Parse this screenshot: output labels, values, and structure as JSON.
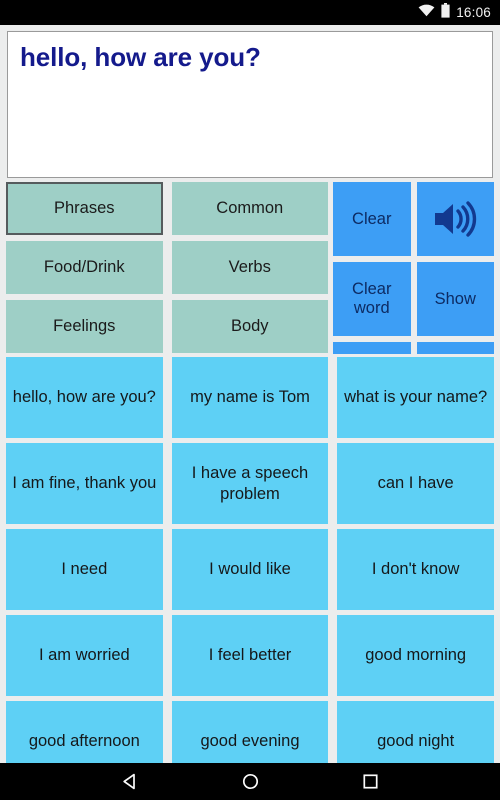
{
  "statusbar": {
    "time": "16:06",
    "wifi_icon": "wifi-icon",
    "battery_icon": "battery-full-icon"
  },
  "output": {
    "text": "hello, how are you?",
    "placeholder": "",
    "text_color": "#141a8c"
  },
  "categories": {
    "selected": "Phrases",
    "items": [
      {
        "label": "Phrases",
        "selected": true
      },
      {
        "label": "Common",
        "selected": false
      },
      {
        "label": "Food/Drink",
        "selected": false
      },
      {
        "label": "Verbs",
        "selected": false
      },
      {
        "label": "Feelings",
        "selected": false
      },
      {
        "label": "Body",
        "selected": false
      },
      {
        "label": "",
        "selected": false
      },
      {
        "label": "",
        "selected": false
      }
    ],
    "color": "#9ecfc6"
  },
  "controls": {
    "color": "#3d9ef5",
    "items": [
      {
        "label": "Clear",
        "icon": ""
      },
      {
        "label": "",
        "icon": "speaker-icon"
      },
      {
        "label": "Clear word",
        "icon": ""
      },
      {
        "label": "Show",
        "icon": ""
      },
      {
        "label": "",
        "icon": ""
      },
      {
        "label": "",
        "icon": ""
      }
    ]
  },
  "phrases": {
    "color": "#5ed0f5",
    "items": [
      "hello, how are you?",
      "my name is Tom",
      "what is your name?",
      "I am fine, thank you",
      "I have a speech problem",
      "can I have",
      "I need",
      "I would like",
      "I don't know",
      "I am worried",
      "I feel better",
      "good morning",
      "good afternoon",
      "good evening",
      "good night"
    ]
  },
  "navbar": {
    "back_icon": "back-triangle-icon",
    "home_icon": "home-circle-icon",
    "recents_icon": "recents-square-icon"
  }
}
